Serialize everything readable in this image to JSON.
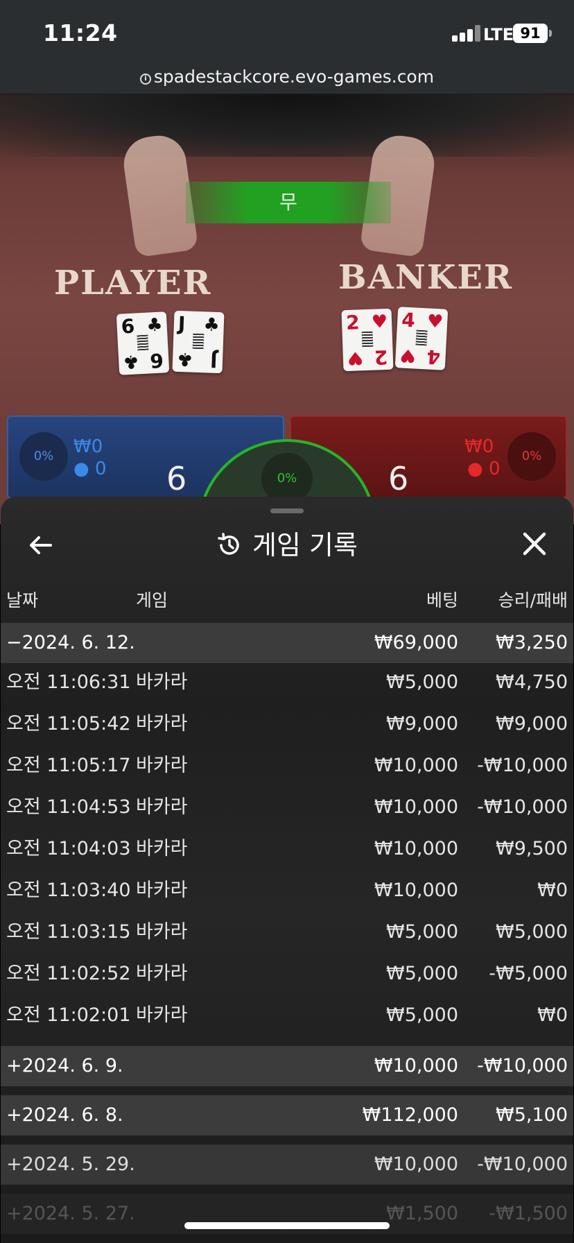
{
  "status_bar": {
    "time": "11:24",
    "network": "LTE",
    "battery": "91"
  },
  "browser": {
    "url": "spadestackcore.evo-games.com"
  },
  "game": {
    "result_banner": "무",
    "player_label": "PLAYER",
    "banker_label": "BANKER",
    "player_cards": [
      {
        "rank": "6",
        "suit": "♣"
      },
      {
        "rank": "J",
        "suit": "♣"
      }
    ],
    "banker_cards": [
      {
        "rank": "2",
        "suit": "♥"
      },
      {
        "rank": "4",
        "suit": "♥"
      }
    ],
    "player": {
      "percent": "0%",
      "amount": "₩0",
      "count": "0",
      "score": "6"
    },
    "banker": {
      "percent": "0%",
      "amount": "₩0",
      "count": "0",
      "score": "6"
    },
    "tie": {
      "percent": "0%"
    }
  },
  "panel": {
    "title": "게임 기록",
    "columns": {
      "date": "날짜",
      "game": "게임",
      "bet": "베팅",
      "win_loss": "승리/패배"
    },
    "groups": [
      {
        "date": "−2024. 6. 12.",
        "bet": "₩69,000",
        "win_loss": "₩3,250",
        "expanded": true,
        "rows": [
          {
            "time": "오전 11:06:31",
            "game": "바카라",
            "bet": "₩5,000",
            "win_loss": "₩4,750"
          },
          {
            "time": "오전 11:05:42",
            "game": "바카라",
            "bet": "₩9,000",
            "win_loss": "₩9,000"
          },
          {
            "time": "오전 11:05:17",
            "game": "바카라",
            "bet": "₩10,000",
            "win_loss": "-₩10,000"
          },
          {
            "time": "오전 11:04:53",
            "game": "바카라",
            "bet": "₩10,000",
            "win_loss": "-₩10,000"
          },
          {
            "time": "오전 11:04:03",
            "game": "바카라",
            "bet": "₩10,000",
            "win_loss": "₩9,500"
          },
          {
            "time": "오전 11:03:40",
            "game": "바카라",
            "bet": "₩10,000",
            "win_loss": "₩0"
          },
          {
            "time": "오전 11:03:15",
            "game": "바카라",
            "bet": "₩5,000",
            "win_loss": "₩5,000"
          },
          {
            "time": "오전 11:02:52",
            "game": "바카라",
            "bet": "₩5,000",
            "win_loss": "-₩5,000"
          },
          {
            "time": "오전 11:02:01",
            "game": "바카라",
            "bet": "₩5,000",
            "win_loss": "₩0"
          }
        ]
      },
      {
        "date": "+2024. 6. 9.",
        "bet": "₩10,000",
        "win_loss": "-₩10,000"
      },
      {
        "date": "+2024. 6. 8.",
        "bet": "₩112,000",
        "win_loss": "₩5,100"
      },
      {
        "date": "+2024. 5. 29.",
        "bet": "₩10,000",
        "win_loss": "-₩10,000"
      },
      {
        "date": "+2024. 5. 27.",
        "bet": "₩1,500",
        "win_loss": "-₩1,500"
      }
    ]
  },
  "colors": {
    "tie_green": "#22a022",
    "player_blue": "#27457e",
    "banker_red": "#7a1c1c",
    "date_row_bg": "#3c3c3c"
  }
}
